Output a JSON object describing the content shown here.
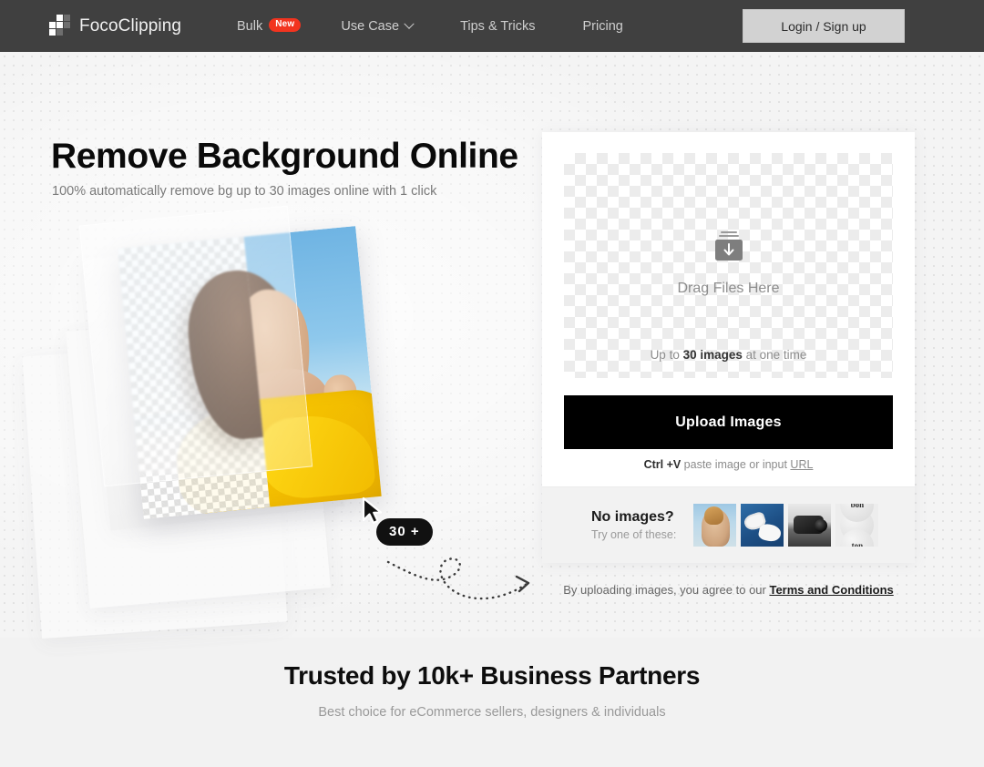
{
  "header": {
    "logo_text": "FocoClipping",
    "logo_icon": "fococlipping-logo-icon",
    "nav": [
      {
        "label": "Bulk",
        "badge": "New"
      },
      {
        "label": "Use Case",
        "caret": "chevron-down-icon"
      },
      {
        "label": "Tips & Tricks"
      },
      {
        "label": "Pricing"
      }
    ],
    "login_label": "Login / Sign up",
    "bg_color": "#404040",
    "login_bg": "#d2d2d2",
    "badge_color": "#f2341f"
  },
  "hero": {
    "title": "Remove Background Online",
    "subtitle": "100% automatically remove bg up to 30 images online with 1 click",
    "count_badge": "30 +",
    "cursor_icon": "mouse-pointer-icon",
    "arrow_icon": "dotted-curved-arrow-icon",
    "photo_alt": "woman-on-beach-with-yellow-scarf"
  },
  "upload": {
    "dropzone_icon": "inbox-download-icon",
    "drag_text": "Drag Files Here",
    "limit_prefix": "Up to ",
    "limit_strong": "30 images",
    "limit_suffix": " at one time",
    "button_label": "Upload Images",
    "paste_strong": "Ctrl +V",
    "paste_text": " paste image or input ",
    "paste_link": "URL",
    "button_bg": "#000000",
    "samples": {
      "title": "No images?",
      "subtitle": "Try one of these:",
      "thumbs": [
        {
          "name": "sample-woman-sunglasses"
        },
        {
          "name": "sample-white-sneakers"
        },
        {
          "name": "sample-black-camera"
        },
        {
          "name": "sample-bonton-logo",
          "label_line1": "bon",
          "label_line2": "ton"
        }
      ]
    }
  },
  "terms": {
    "text": "By uploading images, you agree to our ",
    "link": "Terms and Conditions"
  },
  "trusted": {
    "title": "Trusted by 10k+ Business Partners",
    "subtitle": "Best choice for eCommerce sellers, designers & individuals"
  }
}
